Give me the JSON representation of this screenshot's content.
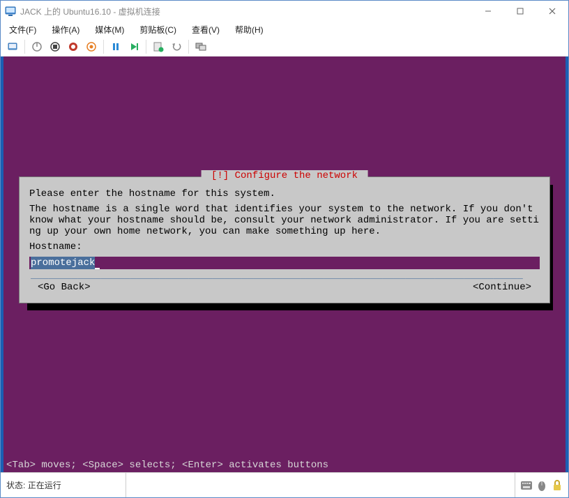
{
  "titlebar": {
    "title": "JACK 上的 Ubuntu16.10 - 虚拟机连接"
  },
  "menubar": {
    "file": "文件(F)",
    "action": "操作(A)",
    "media": "媒体(M)",
    "clipboard": "剪贴板(C)",
    "view": "查看(V)",
    "help": "帮助(H)"
  },
  "dialog": {
    "title": " [!] Configure the network ",
    "line1": "Please enter the hostname for this system.",
    "line2": "The hostname is a single word that identifies your system to the network. If you don't know what your hostname should be, consult your network administrator. If you are setting up your own home network, you can make something up here.",
    "hostname_label": "Hostname:",
    "hostname_value": "promotejack",
    "go_back": "<Go Back>",
    "continue": "<Continue>"
  },
  "vm": {
    "hint": "<Tab> moves; <Space> selects; <Enter> activates buttons"
  },
  "statusbar": {
    "state_label": "状态:",
    "state_value": "正在运行"
  },
  "icons": {
    "app": "monitor-icon",
    "minimize": "minimize-icon",
    "maximize": "maximize-icon",
    "close": "close-icon"
  }
}
